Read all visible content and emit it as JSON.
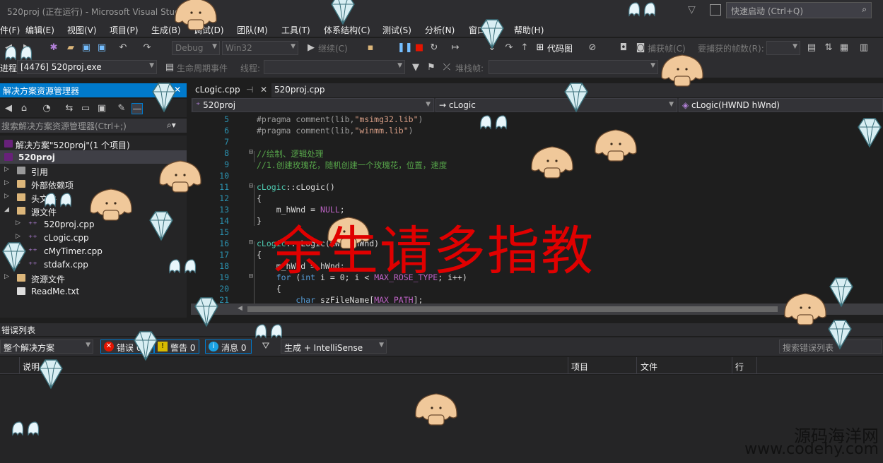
{
  "window": {
    "title": "520proj (正在运行) - Microsoft Visual Studio",
    "quick_launch_placeholder": "快速启动 (Ctrl+Q)"
  },
  "menu": [
    "件(F)",
    "编辑(E)",
    "视图(V)",
    "项目(P)",
    "生成(B)",
    "调试(D)",
    "团队(M)",
    "工具(T)",
    "体系结构(C)",
    "测试(S)",
    "分析(N)",
    "窗口(W)",
    "帮助(H)"
  ],
  "toolbar": {
    "config": "Debug",
    "platform": "Win32",
    "continue_label": "继续(C)",
    "codemap_label": "代码图",
    "capture_label": "捕获帧(C)",
    "frames_label": "要捕获的帧数(R):"
  },
  "toolbar2": {
    "process_label": "进程:",
    "process_value": "[4476] 520proj.exe",
    "lifecycle_label": "生命周期事件",
    "thread_label": "线程:",
    "stackframe_label": "堆栈帧:"
  },
  "solution_explorer": {
    "title": "解决方案资源管理器",
    "search_placeholder": "搜索解决方案资源管理器(Ctrl+;)",
    "items": [
      {
        "label": "解决方案\"520proj\"(1 个项目)",
        "level": 0,
        "expander": ""
      },
      {
        "label": "520proj",
        "level": 0,
        "expander": "",
        "selected": true
      },
      {
        "label": "引用",
        "level": 1,
        "expander": "▷"
      },
      {
        "label": "外部依赖项",
        "level": 1,
        "expander": "▷"
      },
      {
        "label": "头文件",
        "level": 1,
        "expander": "▷"
      },
      {
        "label": "源文件",
        "level": 1,
        "expander": "◢"
      },
      {
        "label": "520proj.cpp",
        "level": 2,
        "expander": "▷"
      },
      {
        "label": "cLogic.cpp",
        "level": 2,
        "expander": "▷"
      },
      {
        "label": "cMyTimer.cpp",
        "level": 2,
        "expander": "▷"
      },
      {
        "label": "stdafx.cpp",
        "level": 2,
        "expander": "▷"
      },
      {
        "label": "资源文件",
        "level": 1,
        "expander": "▷"
      },
      {
        "label": "ReadMe.txt",
        "level": 1,
        "expander": ""
      }
    ]
  },
  "editor": {
    "tabs": [
      {
        "label": "cLogic.cpp",
        "active": true
      },
      {
        "label": "520proj.cpp",
        "active": false
      }
    ],
    "nav": {
      "project": "520proj",
      "scope": "cLogic",
      "member": "cLogic(HWND hWnd)"
    },
    "lines": [
      {
        "n": "5",
        "parts": [
          [
            "c-pre",
            "#pragma comment(lib,"
          ],
          [
            "c-str",
            "\"msimg32.lib\""
          ],
          [
            "c-pre",
            ")"
          ]
        ]
      },
      {
        "n": "6",
        "parts": [
          [
            "c-pre",
            "#pragma comment(lib,"
          ],
          [
            "c-str",
            "\"winmm.lib\""
          ],
          [
            "c-pre",
            ")"
          ]
        ]
      },
      {
        "n": "7",
        "parts": []
      },
      {
        "n": "8",
        "fold": "⊟",
        "parts": [
          [
            "c-cmt",
            "//绘制、逻辑处理"
          ]
        ]
      },
      {
        "n": "9",
        "parts": [
          [
            "c-cmt",
            "//1.创建玫瑰花，随机创建一个玫瑰花，位置，速度"
          ]
        ]
      },
      {
        "n": "10",
        "parts": []
      },
      {
        "n": "11",
        "fold": "⊟",
        "parts": [
          [
            "c-cls",
            "cLogic"
          ],
          [
            "c-def",
            "::cLogic()"
          ]
        ]
      },
      {
        "n": "12",
        "parts": [
          [
            "c-def",
            "{"
          ]
        ]
      },
      {
        "n": "13",
        "parts": [
          [
            "c-def",
            "    m_hWnd = "
          ],
          [
            "c-mac",
            "NULL"
          ],
          [
            "c-def",
            ";"
          ]
        ]
      },
      {
        "n": "14",
        "parts": [
          [
            "c-def",
            "}"
          ]
        ]
      },
      {
        "n": "15",
        "parts": []
      },
      {
        "n": "16",
        "fold": "⊟",
        "parts": [
          [
            "c-cls",
            "cLogic"
          ],
          [
            "c-def",
            "::cLogic(HWND hWnd)"
          ]
        ]
      },
      {
        "n": "17",
        "parts": [
          [
            "c-def",
            "{"
          ]
        ]
      },
      {
        "n": "18",
        "parts": [
          [
            "c-def",
            "    m_hWnd = hWnd;"
          ]
        ]
      },
      {
        "n": "19",
        "fold": "⊟",
        "parts": [
          [
            "c-kw",
            "    for"
          ],
          [
            "c-def",
            " ("
          ],
          [
            "c-kw",
            "int"
          ],
          [
            "c-def",
            " i = 0; i < "
          ],
          [
            "c-mac",
            "MAX_ROSE_TYPE"
          ],
          [
            "c-def",
            "; i++)"
          ]
        ]
      },
      {
        "n": "20",
        "parts": [
          [
            "c-def",
            "    {"
          ]
        ]
      },
      {
        "n": "21",
        "parts": [
          [
            "c-kw",
            "        char"
          ],
          [
            "c-def",
            " szFileName["
          ],
          [
            "c-mac",
            "MAX_PATH"
          ],
          [
            "c-def",
            "];"
          ]
        ]
      }
    ]
  },
  "error_list": {
    "title": "错误列表",
    "scope": "整个解决方案",
    "errors_label": "错误 0",
    "warnings_label": "警告 0",
    "messages_label": "消息 0",
    "build_filter": "生成 + IntelliSense",
    "search_placeholder": "搜索错误列表",
    "columns": [
      "说明",
      "项目",
      "文件",
      "行"
    ]
  },
  "overlay_text": "余生请多指教",
  "watermark": {
    "line1": "源码海洋网",
    "line2": "www.codehy.com"
  },
  "colors": {
    "accent": "#007acc",
    "overlay": "#e00000",
    "background": "#1e1e1e"
  }
}
